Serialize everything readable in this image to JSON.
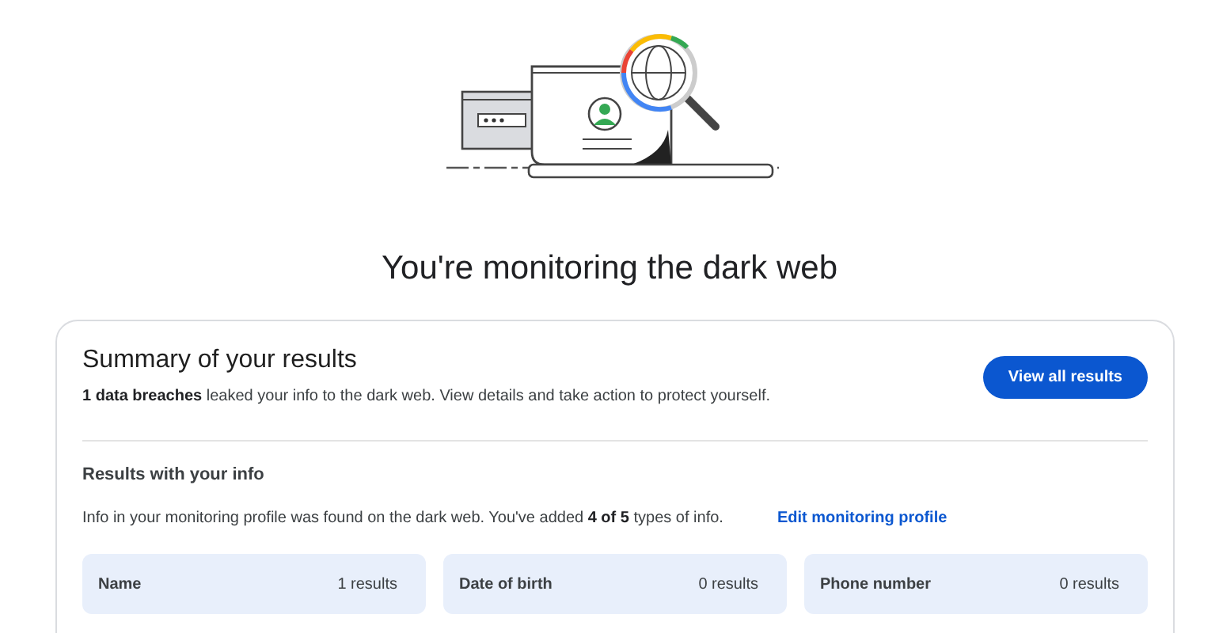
{
  "title": "You're monitoring the dark web",
  "summary": {
    "heading": "Summary of your results",
    "text": "**1 data breaches** leaked your info to the dark web. View details and take action to protect yourself.",
    "button": "View all results"
  },
  "results": {
    "heading": "Results with your info",
    "text": "Info in your monitoring profile was found on the dark web. You've added **4 of 5** types of info.",
    "link": "Edit monitoring profile",
    "tiles": [
      {
        "label": "Name",
        "count": "1 results"
      },
      {
        "label": "Date of birth",
        "count": "0 results"
      },
      {
        "label": "Phone number",
        "count": "0 results"
      }
    ]
  }
}
